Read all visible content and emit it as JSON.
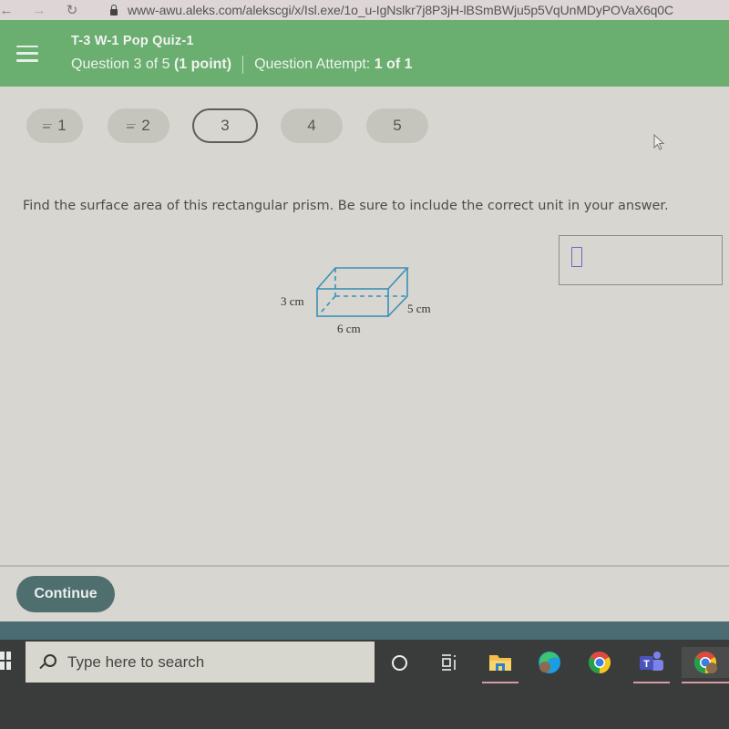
{
  "browser": {
    "url": "www-awu.aleks.com/alekscgi/x/Isl.exe/1o_u-IgNslkr7j8P3jH-lBSmBWju5p5VqUnMDyPOVaX6q0C"
  },
  "header": {
    "quiz_title": "T-3 W-1 Pop Quiz-1",
    "question_progress": "Question 3 of 5",
    "question_points": "(1 point)",
    "attempt_label": "Question Attempt:",
    "attempt_value": "1 of 1",
    "accent_color": "#6aae70"
  },
  "question_nav": {
    "items": [
      {
        "label": "1",
        "answered": true
      },
      {
        "label": "2",
        "answered": true
      },
      {
        "label": "3",
        "answered": false,
        "current": true
      },
      {
        "label": "4",
        "answered": false
      },
      {
        "label": "5",
        "answered": false
      }
    ]
  },
  "question": {
    "prompt": "Find the surface area of this rectangular prism. Be sure to include the correct unit in your answer.",
    "figure": {
      "shape": "rectangular prism",
      "height_label": "3 cm",
      "length_label": "6 cm",
      "depth_label": "5 cm"
    },
    "answer_value": ""
  },
  "footer": {
    "continue_label": "Continue"
  },
  "taskbar": {
    "search_placeholder": "Type here to search",
    "apps": [
      {
        "name": "cortana",
        "icon": "circle-icon"
      },
      {
        "name": "task-view",
        "icon": "task-view-icon"
      },
      {
        "name": "file-explorer",
        "icon": "folder-icon",
        "running": true
      },
      {
        "name": "edge",
        "icon": "edge-icon"
      },
      {
        "name": "chrome",
        "icon": "chrome-icon"
      },
      {
        "name": "teams",
        "icon": "teams-icon",
        "running": true
      },
      {
        "name": "chrome-profile",
        "icon": "chrome-icon",
        "running": true,
        "active": true
      }
    ]
  }
}
